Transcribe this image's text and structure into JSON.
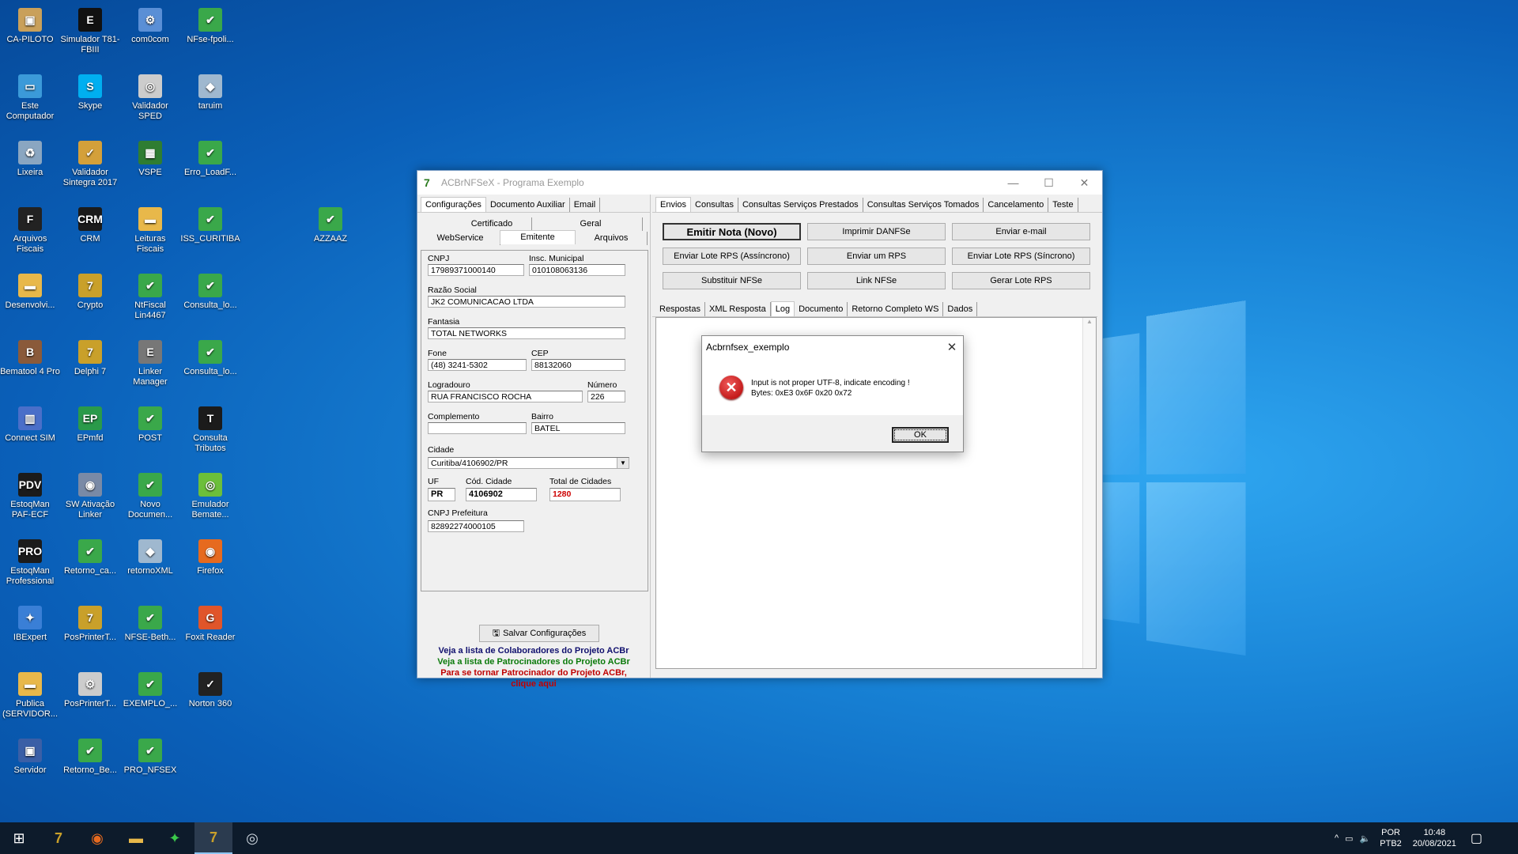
{
  "desktop": {
    "icons": [
      {
        "label": "CA-PILOTO",
        "glyph": "▣",
        "color": "#c9a05a"
      },
      {
        "label": "Simulador T81-FBIII",
        "glyph": "E",
        "color": "#111"
      },
      {
        "label": "com0com",
        "glyph": "⚙",
        "color": "#5a8fd6"
      },
      {
        "label": "NFse-fpoli...",
        "glyph": "✔",
        "color": "#3aa84a"
      },
      {
        "label": "Este Computador",
        "glyph": "▭",
        "color": "#3b9ad9"
      },
      {
        "label": "Skype",
        "glyph": "S",
        "color": "#00aff0"
      },
      {
        "label": "Validador SPED",
        "glyph": "◎",
        "color": "#cccccc"
      },
      {
        "label": "taruim",
        "glyph": "◆",
        "color": "#9fb8cf"
      },
      {
        "label": "Lixeira",
        "glyph": "♻",
        "color": "#8aa6c1"
      },
      {
        "label": "Validador Sintegra 2017",
        "glyph": "✓",
        "color": "#d4a03a"
      },
      {
        "label": "VSPE",
        "glyph": "▦",
        "color": "#2f7d32"
      },
      {
        "label": "Erro_LoadF...",
        "glyph": "✔",
        "color": "#3aa84a"
      },
      {
        "label": "Arquivos Fiscais",
        "glyph": "F",
        "color": "#222"
      },
      {
        "label": "CRM",
        "glyph": "CRM",
        "color": "#1b1b1b"
      },
      {
        "label": "Leituras Fiscais",
        "glyph": "▬",
        "color": "#e8b84a"
      },
      {
        "label": "ISS_CURITIBA",
        "glyph": "✔",
        "color": "#3aa84a"
      },
      {
        "label": "AZZAAZ",
        "glyph": "✔",
        "color": "#3aa84a"
      },
      {
        "label": "Desenvolvi...",
        "glyph": "▬",
        "color": "#e8b84a"
      },
      {
        "label": "Crypto",
        "glyph": "7",
        "color": "#c9a02a"
      },
      {
        "label": "NtFiscal Lin4467",
        "glyph": "✔",
        "color": "#3aa84a"
      },
      {
        "label": "Consulta_lo...",
        "glyph": "✔",
        "color": "#3aa84a"
      },
      {
        "label": "Bematool 4 Pro",
        "glyph": "B",
        "color": "#8a5a3a"
      },
      {
        "label": "Delphi 7",
        "glyph": "7",
        "color": "#c9a02a"
      },
      {
        "label": "Linker Manager",
        "glyph": "E",
        "color": "#777"
      },
      {
        "label": "Consulta_lo...",
        "glyph": "✔",
        "color": "#3aa84a"
      },
      {
        "label": "Connect SIM",
        "glyph": "▥",
        "color": "#4a6fc9"
      },
      {
        "label": "EPmfd",
        "glyph": "EP",
        "color": "#2a9a4a"
      },
      {
        "label": "POST",
        "glyph": "✔",
        "color": "#3aa84a"
      },
      {
        "label": "Consulta Tributos",
        "glyph": "T",
        "color": "#1b1b1b"
      },
      {
        "label": "EstoqMan PAF-ECF",
        "glyph": "PDV",
        "color": "#1b1b1b"
      },
      {
        "label": "SW Ativação Linker",
        "glyph": "◉",
        "color": "#7a8aa6"
      },
      {
        "label": "Novo Documen...",
        "glyph": "✔",
        "color": "#3aa84a"
      },
      {
        "label": "Emulador Bemate...",
        "glyph": "◎",
        "color": "#6cbf3a"
      },
      {
        "label": "EstoqMan Professional",
        "glyph": "PRO",
        "color": "#1b1b1b"
      },
      {
        "label": "Retorno_ca...",
        "glyph": "✔",
        "color": "#3aa84a"
      },
      {
        "label": "retornoXML",
        "glyph": "◆",
        "color": "#9fb8cf"
      },
      {
        "label": "Firefox",
        "glyph": "◉",
        "color": "#e66a1f"
      },
      {
        "label": "IBExpert",
        "glyph": "✦",
        "color": "#3a7fd6"
      },
      {
        "label": "PosPrinterT...",
        "glyph": "7",
        "color": "#c9a02a"
      },
      {
        "label": "NFSE-Beth...",
        "glyph": "✔",
        "color": "#3aa84a"
      },
      {
        "label": "Foxit Reader",
        "glyph": "G",
        "color": "#e0552a"
      },
      {
        "label": "Publica (SERVIDOR...",
        "glyph": "▬",
        "color": "#e8b84a"
      },
      {
        "label": "PosPrinterT...",
        "glyph": "⚙",
        "color": "#cccccc"
      },
      {
        "label": "EXEMPLO_...",
        "glyph": "✔",
        "color": "#3aa84a"
      },
      {
        "label": "Norton 360",
        "glyph": "✓",
        "color": "#222"
      },
      {
        "label": "Servidor",
        "glyph": "▣",
        "color": "#3a5fa6"
      },
      {
        "label": "Retorno_Be...",
        "glyph": "✔",
        "color": "#3aa84a"
      },
      {
        "label": "PRO_NFSEX",
        "glyph": "✔",
        "color": "#3aa84a"
      }
    ]
  },
  "window": {
    "title": "ACBrNFSeX - Programa Exemplo",
    "minimize": "—",
    "maximize": "☐",
    "close": "✕",
    "left_tabs": [
      "Configurações",
      "Documento Auxiliar",
      "Email"
    ],
    "sub_tabs_row1": [
      "Certificado",
      "Geral"
    ],
    "sub_tabs_row2": [
      "WebService",
      "Emitente",
      "Arquivos"
    ],
    "fields": {
      "cnpj_label": "CNPJ",
      "cnpj": "17989371000140",
      "insc_label": "Insc. Municipal",
      "insc": "010108063136",
      "razao_label": "Razão Social",
      "razao": "JK2 COMUNICACAO LTDA",
      "fantasia_label": "Fantasia",
      "fantasia": "TOTAL NETWORKS",
      "fone_label": "Fone",
      "fone": "(48) 3241-5302",
      "cep_label": "CEP",
      "cep": "88132060",
      "logradouro_label": "Logradouro",
      "logradouro": "RUA FRANCISCO ROCHA",
      "numero_label": "Número",
      "numero": "226",
      "complemento_label": "Complemento",
      "complemento": "",
      "bairro_label": "Bairro",
      "bairro": "BATEL",
      "cidade_label": "Cidade",
      "cidade": "Curitiba/4106902/PR",
      "uf_label": "UF",
      "uf": "PR",
      "cod_cidade_label": "Cód. Cidade",
      "cod_cidade": "4106902",
      "total_cidades_label": "Total de Cidades",
      "total_cidades": "1280",
      "cnpj_pref_label": "CNPJ Prefeitura",
      "cnpj_pref": "82892274000105"
    },
    "save_button": "Salvar Configurações",
    "links": [
      "Veja a lista de Colaboradores do Projeto ACBr",
      "Veja a lista de Patrocinadores do Projeto ACBr",
      "Para se tornar Patrocinador do Projeto ACBr,",
      "clique aqui"
    ],
    "right_tabs": [
      "Envios",
      "Consultas",
      "Consultas Serviços Prestados",
      "Consultas Serviços Tomados",
      "Cancelamento",
      "Teste"
    ],
    "action_buttons": [
      "Emitir Nota (Novo)",
      "Imprimir DANFSe",
      "Enviar e-mail",
      "Enviar Lote RPS (Assíncrono)",
      "Enviar um RPS",
      "Enviar Lote RPS (Síncrono)",
      "Substituir NFSe",
      "Link NFSe",
      "Gerar Lote RPS"
    ],
    "result_tabs": [
      "Respostas",
      "XML Resposta",
      "Log",
      "Documento",
      "Retorno Completo WS",
      "Dados"
    ]
  },
  "dialog": {
    "title": "Acbrnfsex_exemplo",
    "close": "✕",
    "message_line1": "Input is not proper UTF-8, indicate encoding !",
    "message_line2": "Bytes: 0xE3 0x6F 0x20 0x72",
    "ok": "OK"
  },
  "taskbar": {
    "start": "⊞",
    "lang": "POR",
    "layout": "PTB2",
    "time": "10:48",
    "date": "20/08/2021"
  }
}
